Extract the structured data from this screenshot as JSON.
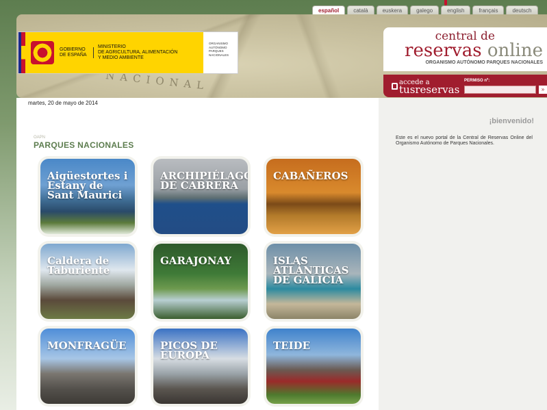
{
  "languages": [
    {
      "label": "español",
      "active": true
    },
    {
      "label": "català",
      "active": false
    },
    {
      "label": "euskera",
      "active": false
    },
    {
      "label": "galego",
      "active": false
    },
    {
      "label": "english",
      "active": false
    },
    {
      "label": "français",
      "active": false
    },
    {
      "label": "deutsch",
      "active": false
    }
  ],
  "header": {
    "map_text": "NACIONAL",
    "gov": "GOBIERNO\nDE ESPAÑA",
    "ministry": "MINISTERIO\nDE AGRICULTURA, ALIMENTACIÓN\nY MEDIO AMBIENTE",
    "organism_small": "ORGANISMO\nAUTÓNOMO\nPARQUES\nNACIONALES"
  },
  "brand": {
    "line1": "central de",
    "line2_a": "reservas",
    "line2_b": " online",
    "line3": "ORGANISMO AUTÓNOMO PARQUES NACIONALES"
  },
  "access": {
    "small": "accede a",
    "big": "tusreservas",
    "permiso_label": "PERMISO nº:",
    "permiso_value": "",
    "go": "»"
  },
  "date": "martes, 20 de mayo de 2014",
  "section": {
    "kicker": "OAPN",
    "title": "PARQUES NACIONALES"
  },
  "parks": [
    {
      "name": "Aigüestortes i Estany de Sant Maurici",
      "bg": "linear-gradient(180deg,#4a88c8 0%,#6fa0d2 35%,#3f6d94 55%,#2a4a6a 70%,#5c7b3b 85%,#dfe8d8 100%)"
    },
    {
      "name": "ARCHIPIÉLAGO DE CABRERA",
      "bg": "linear-gradient(180deg,#b9bcc0 0%,#9aa0a5 40%,#5d6e72 52%,#1f4f8a 60%,#234c84 100%)"
    },
    {
      "name": "CABAÑEROS",
      "bg": "linear-gradient(180deg,#c66d1e 0%,#d98a2d 45%,#7b4a18 60%,#b27a2a 75%,#e2a047 100%)"
    },
    {
      "name": "Caldera de Taburiente",
      "bg": "linear-gradient(180deg,#7fa8cf 0%,#dfe7ee 35%,#9fa7a0 55%,#5b4a3b 75%,#6c7a45 100%)"
    },
    {
      "name": "GARAJONAY",
      "bg": "linear-gradient(180deg,#2e5a2b 0%,#3f7a37 40%,#6e9a4f 60%,#b8cfd2 75%,#3b5e2e 100%)"
    },
    {
      "name": "ISLAS ATLÁNTICAS DE GALICIA",
      "bg": "linear-gradient(180deg,#6d8fa8 0%,#a9b5bb 40%,#2c8aa0 60%,#c4b79a 80%,#8c8468 100%)"
    },
    {
      "name": "MONFRAGÜE",
      "bg": "linear-gradient(180deg,#4f8ed8 0%,#a7c6e6 40%,#7a7670 60%,#54514c 80%,#3d3a35 100%)"
    },
    {
      "name": "PICOS DE EUROPA",
      "bg": "linear-gradient(180deg,#3a72c4 0%,#d7dde3 40%,#9aa3a8 60%,#5b5650 80%,#3a3632 100%)"
    },
    {
      "name": "TEIDE",
      "bg": "linear-gradient(180deg,#3f82cc 0%,#8fb6dc 35%,#6a5a52 55%,#9b2a2a 70%,#4e7a2e 88%,#76a049 100%)"
    }
  ],
  "sidebar": {
    "welcome": "¡bienvenido!",
    "text": "Este es el nuevo portal de la Central de Reservas Online del Organismo Autónomo de Parques Nacionales."
  }
}
